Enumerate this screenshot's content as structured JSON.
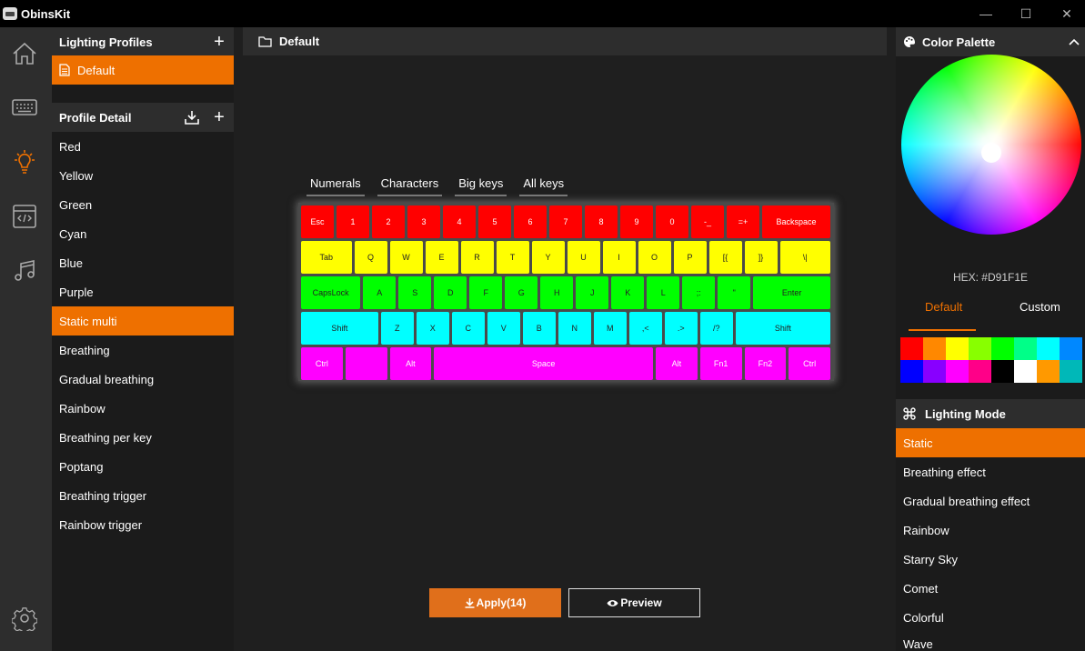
{
  "window": {
    "title": "ObinsKit",
    "minimize": "—",
    "maximize": "☐",
    "close": "✕"
  },
  "nav": [
    "home-icon",
    "keyboard-icon",
    "lightbulb-icon",
    "code-icon",
    "music-icon",
    "settings-icon"
  ],
  "lighting_profiles": {
    "title": "Lighting Profiles",
    "add": "+",
    "items": [
      {
        "label": "Default",
        "active": true
      }
    ]
  },
  "profile_detail": {
    "title": "Profile Detail",
    "add": "+",
    "items": [
      {
        "label": "Red"
      },
      {
        "label": "Yellow"
      },
      {
        "label": "Green"
      },
      {
        "label": "Cyan"
      },
      {
        "label": "Blue"
      },
      {
        "label": "Purple"
      },
      {
        "label": "Static multi",
        "active": true
      },
      {
        "label": "Breathing"
      },
      {
        "label": "Gradual breathing"
      },
      {
        "label": "Rainbow"
      },
      {
        "label": "Breathing per key"
      },
      {
        "label": "Poptang"
      },
      {
        "label": "Breathing trigger"
      },
      {
        "label": "Rainbow trigger"
      }
    ]
  },
  "main": {
    "title": "Default",
    "tabs": [
      "Numerals",
      "Characters",
      "Big keys",
      "All keys"
    ],
    "apply_label": "Apply(14)",
    "preview_label": "Preview"
  },
  "keyboard": {
    "rows": [
      {
        "color": "#ff0000",
        "keys": [
          "Esc",
          "1",
          "2",
          "3",
          "4",
          "5",
          "6",
          "7",
          "8",
          "9",
          "0",
          "-_",
          "=+",
          "Backspace"
        ]
      },
      {
        "color": "#ffff00",
        "keys": [
          "Tab",
          "Q",
          "W",
          "E",
          "R",
          "T",
          "Y",
          "U",
          "I",
          "O",
          "P",
          "[{",
          "]}",
          "\\|"
        ]
      },
      {
        "color": "#00ff00",
        "keys": [
          "CapsLock",
          "A",
          "S",
          "D",
          "F",
          "G",
          "H",
          "J",
          "K",
          "L",
          ";:",
          "\"",
          "Enter"
        ]
      },
      {
        "color": "#00ffff",
        "keys": [
          "Shift",
          "Z",
          "X",
          "C",
          "V",
          "B",
          "N",
          "M",
          ",<",
          ".>",
          "/?",
          "Shift"
        ]
      },
      {
        "color": "#ff00ff",
        "keys": [
          "Ctrl",
          "",
          "Alt",
          "Space",
          "Alt",
          "Fn1",
          "Fn2",
          "Ctrl"
        ]
      }
    ]
  },
  "color_palette": {
    "title": "Color Palette",
    "hex_label": "HEX: #D91F1E",
    "tabs": [
      "Default",
      "Custom"
    ],
    "active_tab": "Default",
    "swatches": [
      "#ff0000",
      "#ff8800",
      "#ffff00",
      "#88ff00",
      "#00ff00",
      "#00ff88",
      "#00ffff",
      "#0088ff",
      "#0000ff",
      "#8800ff",
      "#ff00ff",
      "#ff0088",
      "#000000",
      "#ffffff",
      "#ff9900",
      "#00b8b8"
    ]
  },
  "lighting_mode": {
    "title": "Lighting Mode",
    "items": [
      {
        "label": "Static",
        "active": true
      },
      {
        "label": "Breathing effect"
      },
      {
        "label": "Gradual breathing effect"
      },
      {
        "label": "Rainbow"
      },
      {
        "label": "Starry Sky"
      },
      {
        "label": "Comet"
      },
      {
        "label": "Colorful"
      },
      {
        "label": "Wave"
      }
    ]
  },
  "accent_color": "#ee7000"
}
